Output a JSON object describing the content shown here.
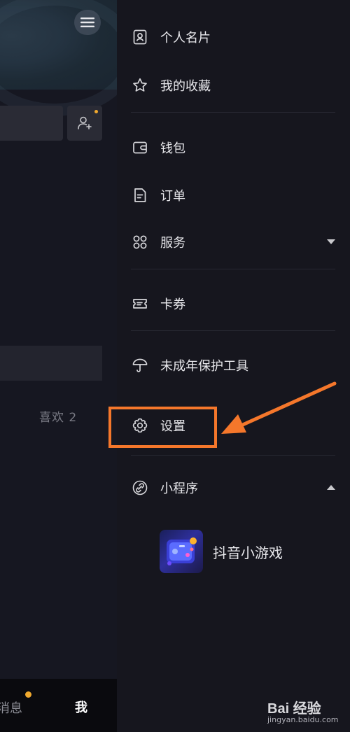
{
  "left_page": {
    "likes_tab": "喜欢 2",
    "bottom_nav": {
      "messages": "消息",
      "me": "我"
    }
  },
  "drawer": {
    "items": [
      {
        "label": "个人名片",
        "icon": "id-card-icon"
      },
      {
        "label": "我的收藏",
        "icon": "star-icon"
      },
      {
        "label": "钱包",
        "icon": "wallet-icon"
      },
      {
        "label": "订单",
        "icon": "order-document-icon"
      },
      {
        "label": "服务",
        "icon": "grid-services-icon"
      },
      {
        "label": "卡券",
        "icon": "ticket-icon"
      },
      {
        "label": "未成年保护工具",
        "icon": "umbrella-icon"
      },
      {
        "label": "设置",
        "icon": "gear-icon"
      },
      {
        "label": "小程序",
        "icon": "link-icon"
      }
    ],
    "mini_program": {
      "label": "抖音小游戏"
    }
  },
  "annotation": {
    "color": "#f5772b"
  },
  "watermark": {
    "brand": "Bai 经验",
    "url": "jingyan.baidu.com"
  },
  "colors": {
    "background": "#16161e",
    "text": "#e8e8ec",
    "notice_dot": "#f0a92e"
  }
}
